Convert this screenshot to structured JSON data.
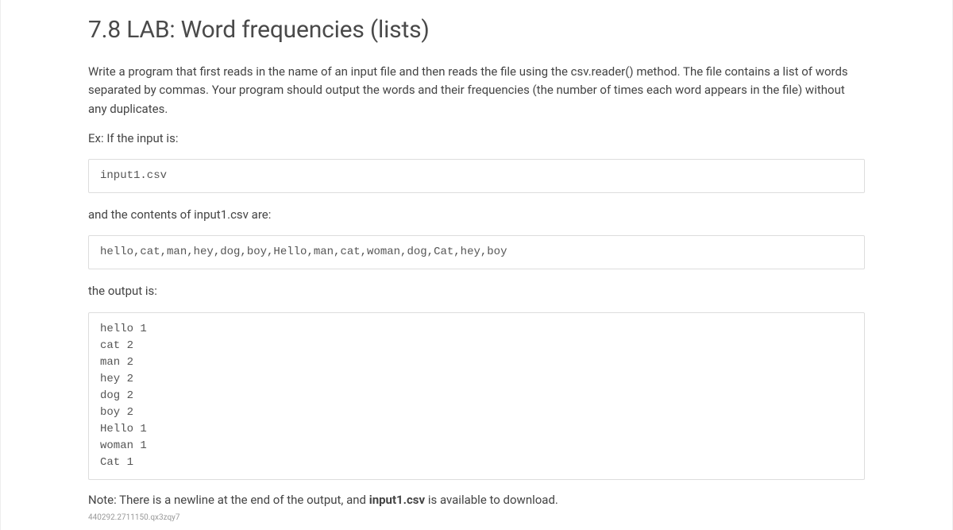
{
  "title": "7.8 LAB: Word frequencies (lists)",
  "intro": "Write a program that first reads in the name of an input file and then reads the file using the csv.reader() method. The file contains a list of words separated by commas. Your program should output the words and their frequencies (the number of times each word appears in the file) without any duplicates.",
  "example_label": "Ex: If the input is:",
  "input_example": "input1.csv",
  "contents_label": "and the contents of input1.csv are:",
  "csv_contents": "hello,cat,man,hey,dog,boy,Hello,man,cat,woman,dog,Cat,hey,boy",
  "output_label": "the output is:",
  "output_example": "hello 1\ncat 2\nman 2\nhey 2\ndog 2\nboy 2\nHello 1\nwoman 1\nCat 1",
  "note_prefix": "Note: There is a newline at the end of the output, and ",
  "note_bold": "input1.csv",
  "note_suffix": " is available to download.",
  "footer_id": "440292.2711150.qx3zqy7"
}
